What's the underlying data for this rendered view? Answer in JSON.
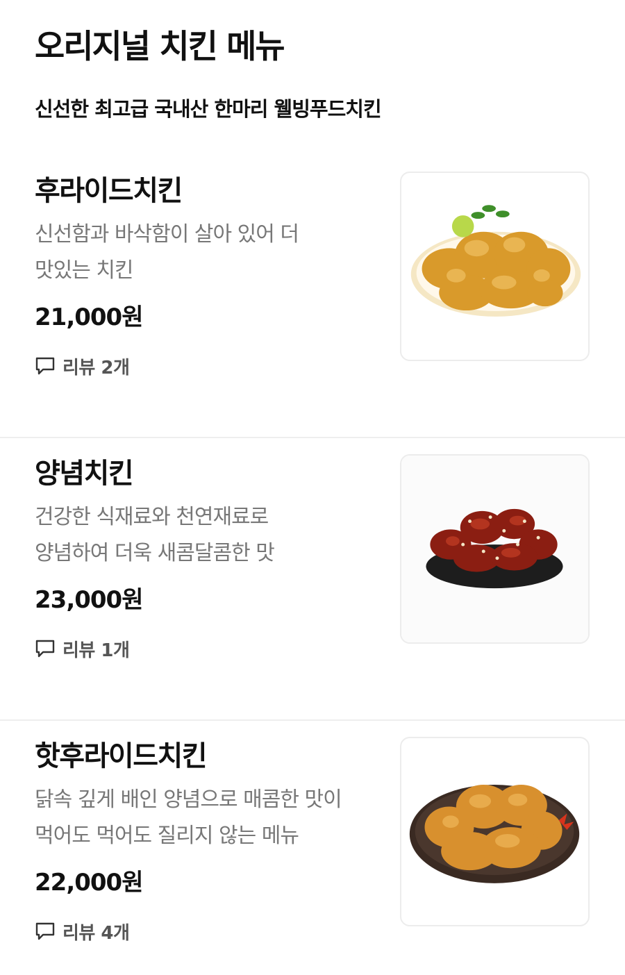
{
  "header": {
    "title": "오리지널 치킨 메뉴",
    "subtitle": "신선한 최고급 국내산 한마리 웰빙푸드치킨"
  },
  "menu": [
    {
      "name": "후라이드치킨",
      "desc_lines": [
        "신선함과 바삭함이 살아 있어 더",
        "맛있는 치킨"
      ],
      "price": "21,000원",
      "review": "리뷰 2개",
      "image": "fried-chicken-photo"
    },
    {
      "name": "양념치킨",
      "desc_lines": [
        "건강한 식재료와 천연재료로",
        "양념하여 더욱 새콤달콤한 맛"
      ],
      "price": "23,000원",
      "review": "리뷰 1개",
      "image": "seasoned-chicken-photo"
    },
    {
      "name": "핫후라이드치킨",
      "desc_lines": [
        "닭속 깊게 배인 양념으로 매콤한 맛이",
        "먹어도 먹어도 질리지 않는 메뉴"
      ],
      "price": "22,000원",
      "review": "리뷰 4개",
      "image": "hot-fried-chicken-photo"
    }
  ],
  "icons": {
    "review": "comment-icon"
  },
  "colors": {
    "text": "#111111",
    "muted": "#777777",
    "divider": "#eeeeee"
  }
}
